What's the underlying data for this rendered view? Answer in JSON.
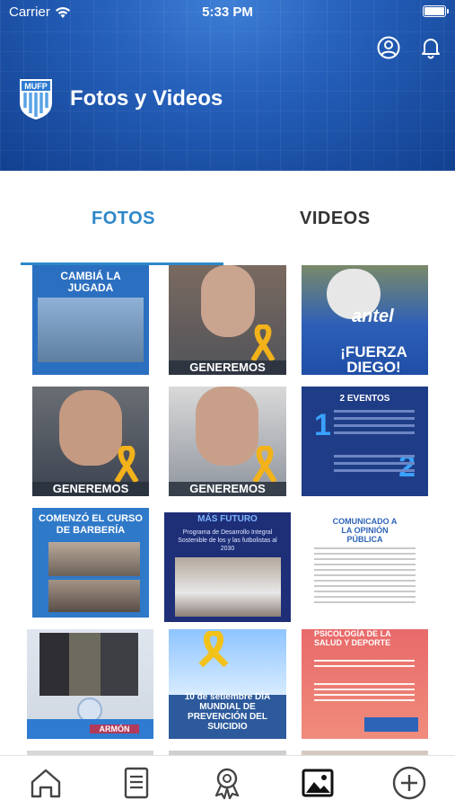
{
  "status_bar": {
    "carrier": "Carrier",
    "time": "5:33 PM"
  },
  "header": {
    "title": "Fotos y Videos",
    "logo_text": "MUFP"
  },
  "tabs": [
    {
      "label": "FOTOS",
      "active": true
    },
    {
      "label": "VIDEOS",
      "active": false
    }
  ],
  "gallery": {
    "items": [
      {
        "caption": "CAMBIÁ LA JUGADA"
      },
      {
        "caption": "GENEREMOS"
      },
      {
        "caption": "¡FUERZA DIEGO!",
        "brand": "antel"
      },
      {
        "caption": "GENEREMOS"
      },
      {
        "caption": "GENEREMOS"
      },
      {
        "caption": "2 EVENTOS"
      },
      {
        "caption": "COMENZÓ EL CURSO DE BARBERÍA"
      },
      {
        "caption": "Programa de Desarrollo Integral Sostenible de los y las futbolistas al 2030",
        "brand": "MÁS FUTURO"
      },
      {
        "caption": "COMUNICADO A LA OPINIÓN PÚBLICA"
      },
      {
        "caption": "ARMÓN"
      },
      {
        "caption": "10 de setiembre DÍA MUNDIAL DE PREVENCIÓN DEL SUICIDIO"
      },
      {
        "caption": "PSICOLOGÍA DE LA SALUD Y DEPORTE"
      }
    ]
  },
  "bottom_nav": [
    {
      "icon": "home-icon",
      "active": false
    },
    {
      "icon": "document-icon",
      "active": false
    },
    {
      "icon": "award-ribbon-icon",
      "active": false
    },
    {
      "icon": "gallery-icon",
      "active": true
    },
    {
      "icon": "plus-circle-icon",
      "active": false
    }
  ],
  "colors": {
    "accent": "#2e87c8",
    "header": "#2560bb",
    "ribbon": "#f3b21a"
  }
}
